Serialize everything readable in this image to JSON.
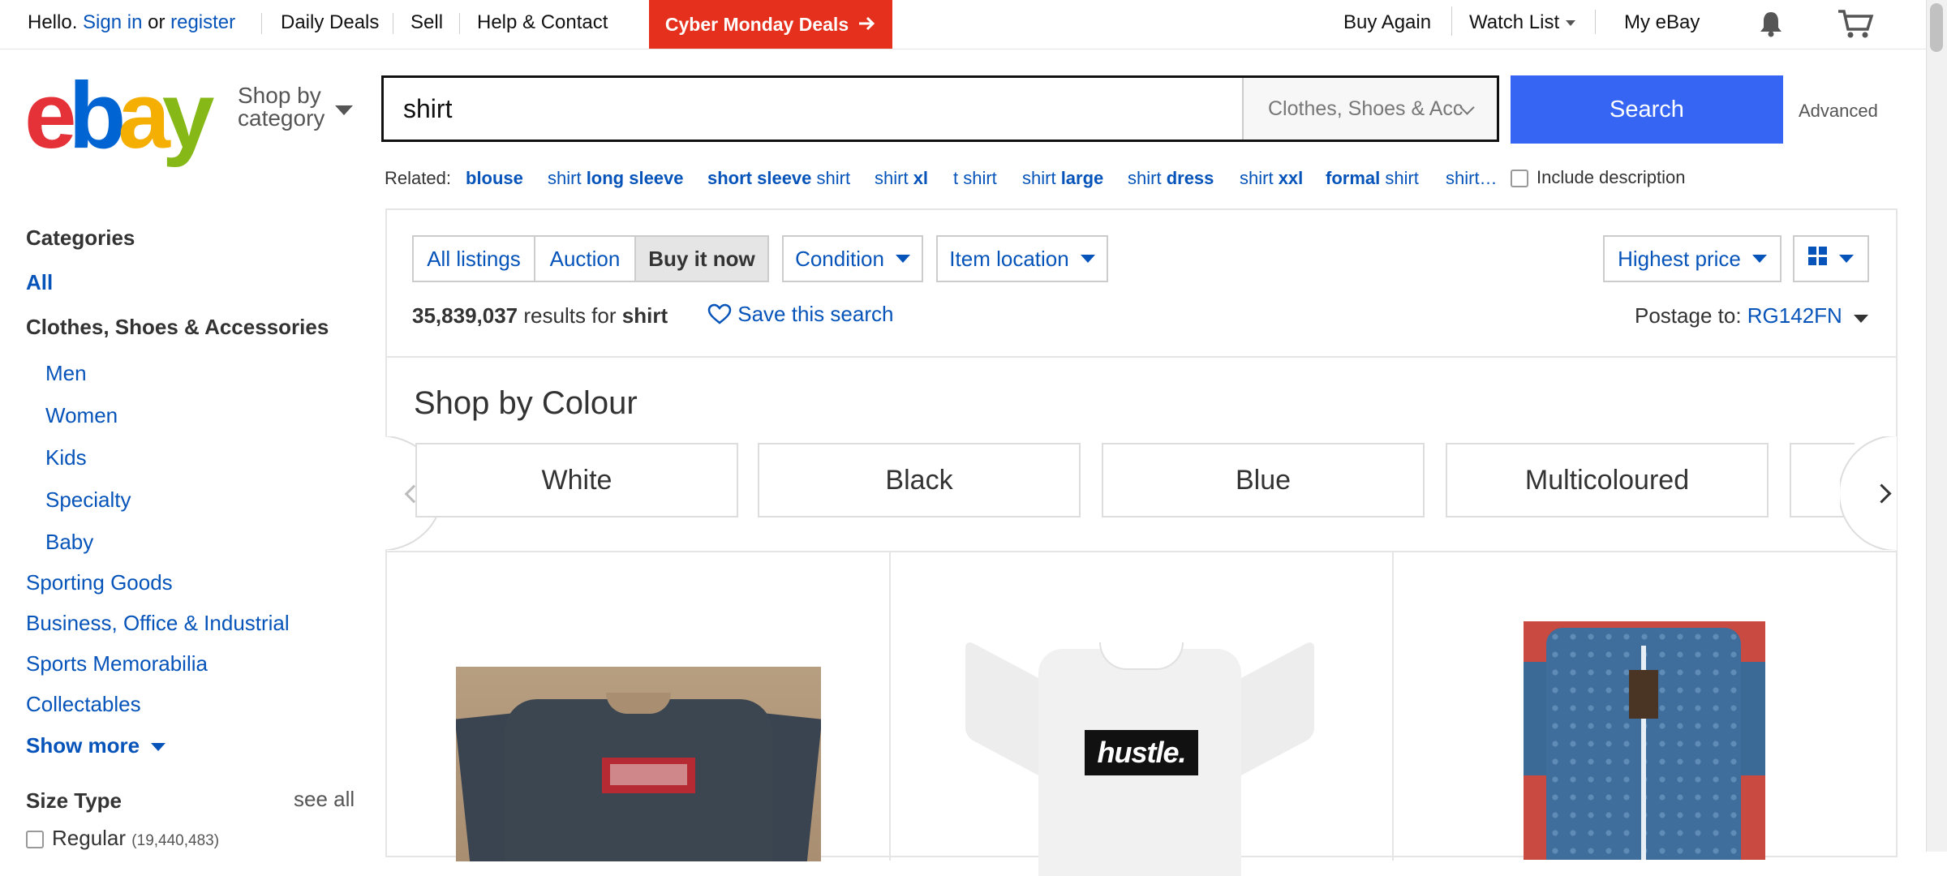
{
  "topbar": {
    "hello": "Hello.",
    "sign_in": "Sign in",
    "or": "or",
    "register": "register",
    "daily_deals": "Daily Deals",
    "sell": "Sell",
    "help": "Help & Contact",
    "cyber_monday": "Cyber Monday Deals",
    "buy_again": "Buy Again",
    "watch_list": "Watch List",
    "my_ebay": "My eBay"
  },
  "header": {
    "logo_letters": [
      "e",
      "b",
      "a",
      "y"
    ],
    "logo_colors": [
      "#e53238",
      "#0064d2",
      "#f5af02",
      "#86b817"
    ],
    "shop_by_line1": "Shop by",
    "shop_by_line2": "category",
    "search_value": "shirt",
    "category_select": "Clothes, Shoes & Acc",
    "search_button": "Search",
    "advanced": "Advanced"
  },
  "related": {
    "label": "Related:",
    "items": [
      {
        "parts": [
          [
            "blouse",
            true
          ]
        ]
      },
      {
        "parts": [
          [
            "shirt ",
            false
          ],
          [
            "long sleeve",
            true
          ]
        ]
      },
      {
        "parts": [
          [
            "short sleeve",
            true
          ],
          [
            " shirt",
            false
          ]
        ]
      },
      {
        "parts": [
          [
            "shirt ",
            false
          ],
          [
            "xl",
            true
          ]
        ]
      },
      {
        "parts": [
          [
            "t shirt",
            false
          ]
        ]
      },
      {
        "parts": [
          [
            "shirt ",
            false
          ],
          [
            "large",
            true
          ]
        ]
      },
      {
        "parts": [
          [
            "shirt ",
            false
          ],
          [
            "dress",
            true
          ]
        ]
      },
      {
        "parts": [
          [
            "shirt ",
            false
          ],
          [
            "xxl",
            true
          ]
        ]
      },
      {
        "parts": [
          [
            "formal",
            true
          ],
          [
            " shirt",
            false
          ]
        ]
      },
      {
        "parts": [
          [
            "shirt…",
            false
          ]
        ]
      }
    ],
    "include_description": "Include description"
  },
  "sidebar": {
    "categories_title": "Categories",
    "all": "All",
    "current_category": "Clothes, Shoes & Accessories",
    "subcategories": [
      "Men",
      "Women",
      "Kids",
      "Specialty",
      "Baby"
    ],
    "other_categories": [
      "Sporting Goods",
      "Business, Office & Industrial",
      "Sports Memorabilia",
      "Collectables"
    ],
    "show_more": "Show more",
    "size_type_title": "Size Type",
    "see_all": "see all",
    "size_options": [
      {
        "label": "Regular",
        "count": "(19,440,483)"
      }
    ]
  },
  "toolbar": {
    "tabs": [
      "All listings",
      "Auction",
      "Buy it now"
    ],
    "active_tab": "Buy it now",
    "condition": "Condition",
    "item_location": "Item location",
    "sort": "Highest price",
    "view_icon": "grid-view-icon"
  },
  "results": {
    "count": "35,839,037",
    "results_for": "results for",
    "query": "shirt",
    "save_search": "Save this search",
    "postage_label": "Postage to:",
    "postcode": "RG142FN"
  },
  "colour_section": {
    "heading": "Shop by Colour",
    "chips": [
      "White",
      "Black",
      "Blue",
      "Multicoloured"
    ]
  },
  "products": [
    {
      "image": "grey long sleeve shirt"
    },
    {
      "image": "white tee",
      "print": "hustle."
    },
    {
      "image": "blue baseball jersey"
    }
  ],
  "colors": {
    "link": "#0654ba",
    "search_button": "#3665f3",
    "cyber_banner": "#e4301c"
  }
}
